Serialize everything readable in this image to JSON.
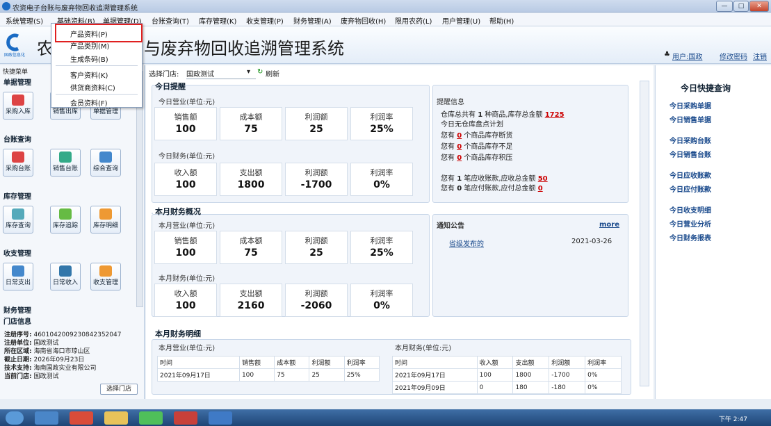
{
  "window": {
    "title": "农资电子台账与废弃物回收追溯管理系统"
  },
  "menu": [
    "系统管理(S)",
    "基础资料(B)",
    "单据管理(D)",
    "台账查询(T)",
    "库存管理(K)",
    "收支管理(P)",
    "财务管理(A)",
    "废弃物回收(H)",
    "限用农药(L)",
    "用户管理(U)",
    "帮助(H)"
  ],
  "dropdown": [
    "产品资料(P)",
    "产品类别(M)",
    "生成条码(B)",
    "客户资料(K)",
    "供货商资料(C)",
    "会员资料(F)"
  ],
  "header": {
    "logo_text": "国政信息化",
    "title_left": "农",
    "title_right": "与废弃物回收追溯管理系统",
    "user_label": "用户:国政",
    "change_pw": "修改密码",
    "logout": "注销"
  },
  "left": {
    "title": "快捷菜单",
    "sections": [
      "单据管理",
      "台账查询",
      "库存管理",
      "收支管理",
      "财务管理"
    ],
    "tiles": [
      [
        "采购入库",
        "销售出库",
        "单据管理"
      ],
      [
        "采购台账",
        "销售台账",
        "综合查询"
      ],
      [
        "库存查询",
        "库存追踪",
        "库存明细"
      ],
      [
        "日常支出",
        "日常收入",
        "收支管理"
      ]
    ],
    "store_title": "门店信息",
    "info": [
      [
        "注册序号:",
        "46010420092308423520​47"
      ],
      [
        "注册单位:",
        "国政测试"
      ],
      [
        "所在区域:",
        "海南省海口市琼山区"
      ],
      [
        "截止日期:",
        "2026年09月23日"
      ],
      [
        "技术支持:",
        "海南国政实业有限公司"
      ],
      [
        "当前门店:",
        "国政测试"
      ]
    ],
    "select_store_btn": "选择门店"
  },
  "toolbar": {
    "label": "选择门店:",
    "store": "国政测试",
    "refresh": "刷新"
  },
  "today": {
    "title": "今日提醒",
    "business_label": "今日营业(单位:元)",
    "business": [
      [
        "销售额",
        "100"
      ],
      [
        "成本额",
        "75"
      ],
      [
        "利润额",
        "25"
      ],
      [
        "利润率",
        "25%"
      ]
    ],
    "finance_label": "今日财务(单位:元)",
    "finance": [
      [
        "收入额",
        "100"
      ],
      [
        "支出额",
        "1800"
      ],
      [
        "利润额",
        "-1700"
      ],
      [
        "利润率",
        "0%"
      ]
    ]
  },
  "reminder": {
    "title": "提醒信息",
    "l1a": "仓库总共有",
    "l1b": "1",
    "l1c": "种商品,库存总金额",
    "l1d": "1725",
    "l2": "今日无仓库盘点计划",
    "stock": [
      [
        "您有",
        "0",
        "个商品库存断货"
      ],
      [
        "您有",
        "0",
        "个商品库存不足"
      ],
      [
        "您有",
        "0",
        "个商品库存积压"
      ]
    ],
    "ar": [
      "您有",
      "1",
      "笔应收账款,应收总金额",
      "50"
    ],
    "ap": [
      "您有",
      "0",
      "笔应付账款,应付总金额",
      "0"
    ]
  },
  "month": {
    "title": "本月财务概况",
    "business_label": "本月营业(单位:元)",
    "business": [
      [
        "销售额",
        "100"
      ],
      [
        "成本额",
        "75"
      ],
      [
        "利润额",
        "25"
      ],
      [
        "利润率",
        "25%"
      ]
    ],
    "finance_label": "本月财务(单位:元)",
    "finance": [
      [
        "收入额",
        "100"
      ],
      [
        "支出额",
        "2160"
      ],
      [
        "利润额",
        "-2060"
      ],
      [
        "利润率",
        "0%"
      ]
    ]
  },
  "notice": {
    "title": "通知公告",
    "more": "more",
    "item": "省级发布的",
    "date": "2021-03-26"
  },
  "detail": {
    "title": "本月财务明细",
    "business_label": "本月营业(单位:元)",
    "finance_label": "本月财务(单位:元)",
    "bhead": [
      "时间",
      "销售额",
      "成本额",
      "利润额",
      "利润率"
    ],
    "brows": [
      [
        "2021年09月17日",
        "100",
        "75",
        "25",
        "25%"
      ]
    ],
    "fhead": [
      "时间",
      "收入额",
      "支出额",
      "利润额",
      "利润率"
    ],
    "frows": [
      [
        "2021年09月17日",
        "100",
        "1800",
        "-1700",
        "0%"
      ],
      [
        "2021年09月09日",
        "0",
        "180",
        "-180",
        "0%"
      ]
    ]
  },
  "right": {
    "title": "今日快捷查询",
    "items": [
      "今日采购单据",
      "今日销售单据",
      "今日采购台账",
      "今日销售台账",
      "今日应收账款",
      "今日应付账款",
      "今日收支明细",
      "今日营业分析",
      "今日财务报表"
    ]
  },
  "clock": "下午 2:47"
}
